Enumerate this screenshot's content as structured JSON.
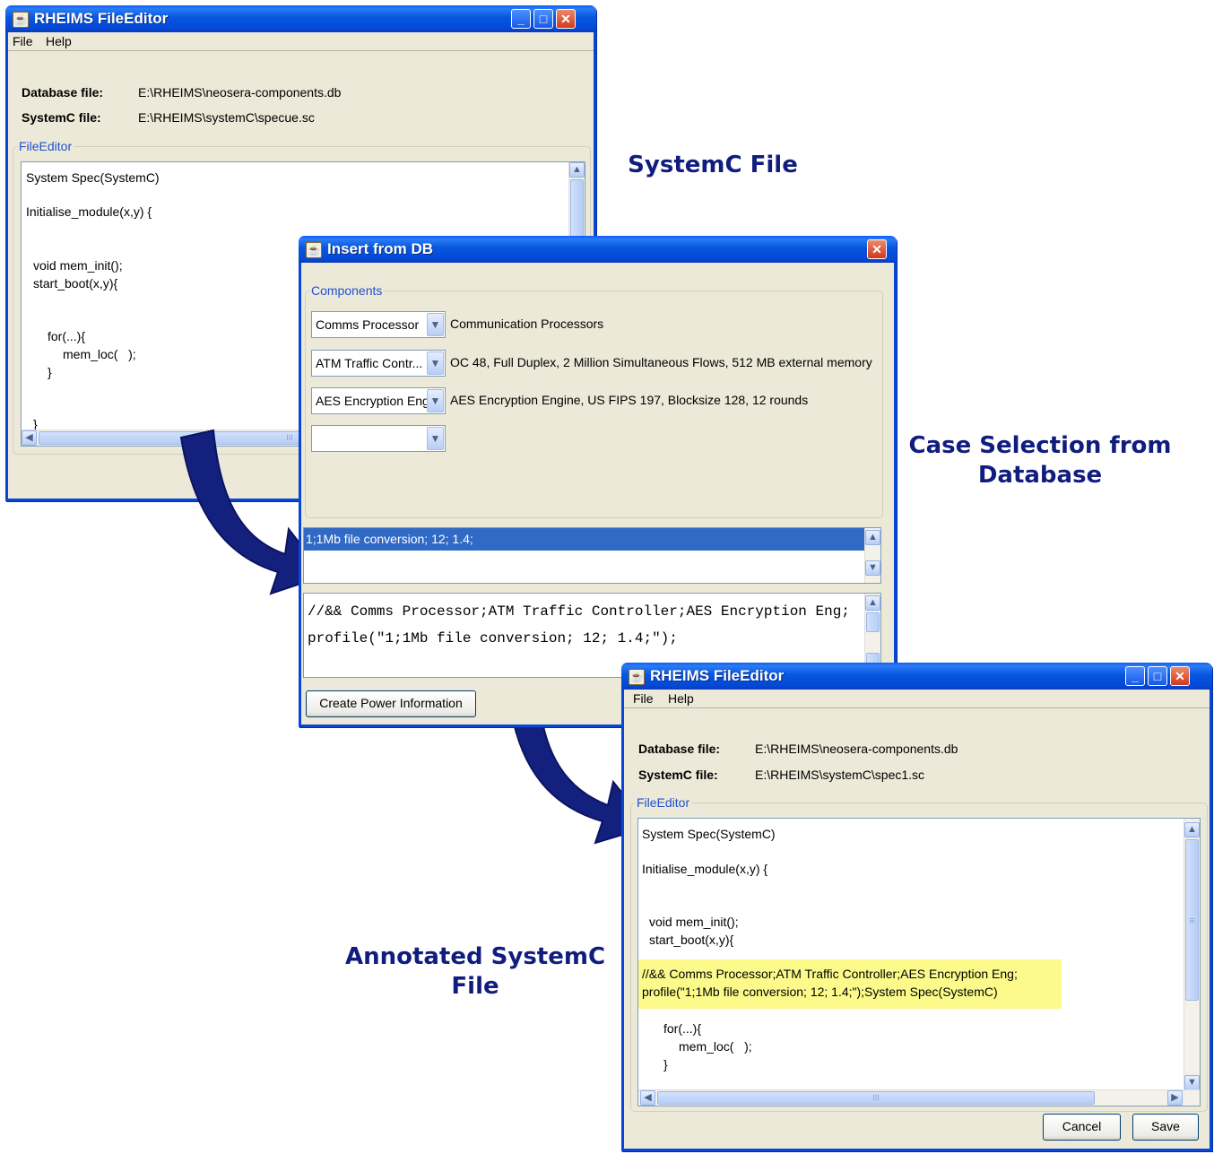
{
  "callouts": {
    "systemc_file": "SystemC File",
    "case_selection": "Case Selection from Database",
    "annotated": "Annotated SystemC File"
  },
  "editor1": {
    "title": "RHEIMS FileEditor",
    "menu": [
      "File",
      "Help"
    ],
    "database_label": "Database file:",
    "database_value": "E:\\RHEIMS\\neosera-components.db",
    "systemc_label": "SystemC file:",
    "systemc_value": "E:\\RHEIMS\\systemC\\specue.sc",
    "group_title": "FileEditor",
    "lines": [
      "System Spec(SystemC)",
      "Initialise_module(x,y) {",
      "void mem_init();",
      "start_boot(x,y){",
      "for(...){",
      "mem_loc(   );",
      "}",
      "}"
    ],
    "hscroll_grip": "III"
  },
  "insert_dialog": {
    "title": "Insert from DB",
    "group_title": "Components",
    "components": [
      {
        "selected": "Comms Processor",
        "description": "Communication Processors"
      },
      {
        "selected": "ATM Traffic Contr...",
        "description": "OC 48, Full Duplex, 2 Million Simultaneous Flows, 512 MB external memory"
      },
      {
        "selected": "AES Encryption Eng",
        "description": "AES Encryption Engine, US FIPS 197, Blocksize 128, 12 rounds"
      },
      {
        "selected": "",
        "description": ""
      }
    ],
    "cases": [
      "1;1Mb file conversion; 12; 1.4;"
    ],
    "output_lines": [
      "//&& Comms Processor;ATM Traffic Controller;AES Encryption Eng;",
      "profile(\"1;1Mb file conversion; 12; 1.4;\");"
    ],
    "create_button": "Create Power Information"
  },
  "editor2": {
    "title": "RHEIMS FileEditor",
    "menu": [
      "File",
      "Help"
    ],
    "database_label": "Database file:",
    "database_value": "E:\\RHEIMS\\neosera-components.db",
    "systemc_label": "SystemC file:",
    "systemc_value": "E:\\RHEIMS\\systemC\\spec1.sc",
    "group_title": "FileEditor",
    "lines": [
      "System Spec(SystemC)",
      "Initialise_module(x,y) {",
      "void mem_init();",
      "start_boot(x,y){",
      "for(...){",
      "mem_loc(   );",
      "}"
    ],
    "highlight_lines": [
      "//&& Comms Processor;ATM Traffic Controller;AES Encryption Eng;",
      "profile(\"1;1Mb file conversion; 12; 1.4;\");System Spec(SystemC)"
    ],
    "highlight_color": "#fbfa8a",
    "hscroll_grip": "III",
    "vscroll_grip": "≡",
    "cancel_button": "Cancel",
    "save_button": "Save"
  },
  "colors": {
    "title_blue": "#0a46d6",
    "callout_text": "#111d7e",
    "arrow_fill": "#14207e",
    "selection_blue": "#316ac5"
  }
}
